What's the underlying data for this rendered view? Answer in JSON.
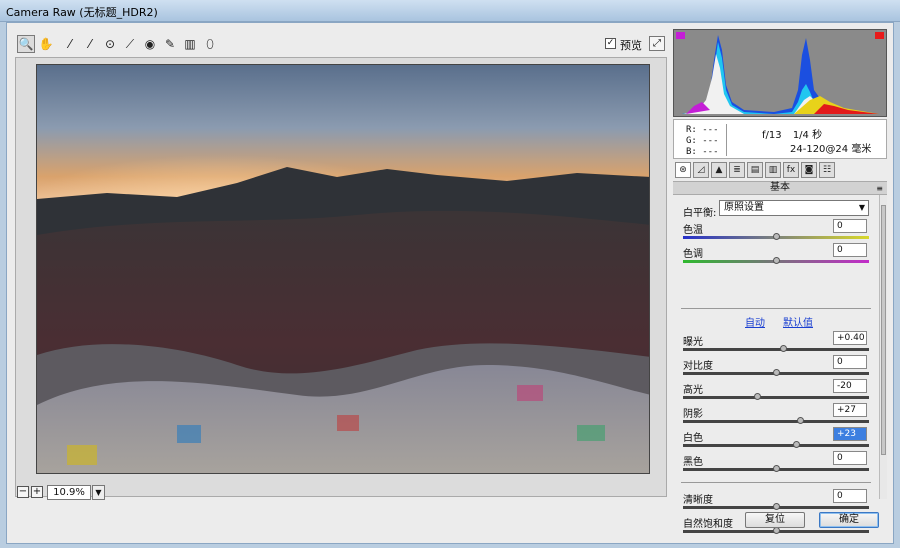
{
  "window": {
    "title": "Camera Raw (无标题_HDR2)"
  },
  "toolbar": {
    "preview_label": "预览",
    "preview_checked": true
  },
  "zoom": {
    "minus": "−",
    "plus": "+",
    "value": "10.9%"
  },
  "info": {
    "r": "R:  ---",
    "g": "G:  ---",
    "b": "B:  ---",
    "aperture": "f/13",
    "shutter": "1/4 秒",
    "lens": "24-120@24 毫米"
  },
  "panel": {
    "title": "基本"
  },
  "white_balance": {
    "label": "白平衡:",
    "value": "原照设置"
  },
  "links": {
    "auto": "自动",
    "default": "默认值"
  },
  "sliders": [
    {
      "label": "色温",
      "value": "0",
      "position": 0.5
    },
    {
      "label": "色调",
      "value": "0",
      "position": 0.5
    },
    {
      "label": "曝光",
      "value": "+0.40",
      "position": 0.54
    },
    {
      "label": "对比度",
      "value": "0",
      "position": 0.5
    },
    {
      "label": "高光",
      "value": "-20",
      "position": 0.4
    },
    {
      "label": "阴影",
      "value": "+27",
      "position": 0.63
    },
    {
      "label": "白色",
      "value": "+23",
      "position": 0.61,
      "selected": true
    },
    {
      "label": "黑色",
      "value": "0",
      "position": 0.5
    },
    {
      "label": "清晰度",
      "value": "0",
      "position": 0.5
    },
    {
      "label": "自然饱和度",
      "value": "0",
      "position": 0.5
    }
  ],
  "buttons": {
    "reset": "复位",
    "ok": "确定"
  },
  "colors": {
    "accent": "#3d7fe0",
    "temp_start": "#2630c9",
    "temp_end": "#d8d82b",
    "tint_start": "#2fb92f",
    "tint_end": "#c22bc9"
  }
}
